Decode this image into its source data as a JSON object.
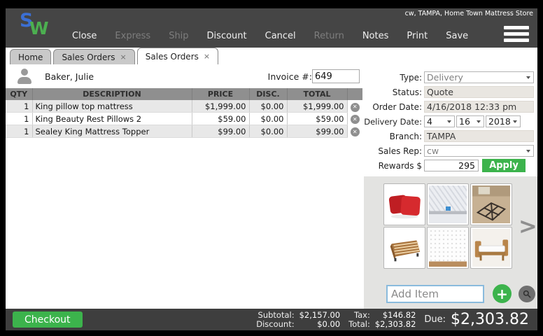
{
  "titlebar": {
    "account_label": "cw, TAMPA, Home Town Mattress Store"
  },
  "logo": {
    "letter_s": "S",
    "letter_w": "W"
  },
  "menu": {
    "items": [
      {
        "label": "Close",
        "enabled": true
      },
      {
        "label": "Express",
        "enabled": false
      },
      {
        "label": "Ship",
        "enabled": false
      },
      {
        "label": "Discount",
        "enabled": true
      },
      {
        "label": "Cancel",
        "enabled": true
      },
      {
        "label": "Return",
        "enabled": false
      },
      {
        "label": "Notes",
        "enabled": true
      },
      {
        "label": "Print",
        "enabled": true
      },
      {
        "label": "Save",
        "enabled": true
      }
    ]
  },
  "tabs": [
    {
      "label": "Home",
      "closable": false,
      "active": false
    },
    {
      "label": "Sales Orders",
      "closable": true,
      "active": false
    },
    {
      "label": "Sales Orders",
      "closable": true,
      "active": true
    }
  ],
  "customer": {
    "name": "Baker, Julie"
  },
  "invoice": {
    "label": "Invoice #:",
    "value": "649"
  },
  "order_table": {
    "headers": [
      "QTY",
      "DESCRIPTION",
      "PRICE",
      "DISC.",
      "TOTAL"
    ],
    "rows": [
      {
        "qty": "1",
        "description": "King pillow top mattress",
        "price": "$1,999.00",
        "disc": "$0.00",
        "total": "$1,999.00"
      },
      {
        "qty": "1",
        "description": "King Beauty Rest Pillows 2",
        "price": "$59.00",
        "disc": "$0.00",
        "total": "$59.00"
      },
      {
        "qty": "1",
        "description": "Sealey King Mattress Topper",
        "price": "$99.00",
        "disc": "$0.00",
        "total": "$99.00"
      }
    ]
  },
  "form": {
    "type": {
      "label": "Type:",
      "value": "Delivery"
    },
    "status": {
      "label": "Status:",
      "value": "Quote"
    },
    "order_date": {
      "label": "Order Date:",
      "value": "4/16/2018 12:33 pm"
    },
    "delivery_date": {
      "label": "Delivery Date:",
      "month": "4",
      "day": "16",
      "year": "2018"
    },
    "branch": {
      "label": "Branch:",
      "value": "TAMPA"
    },
    "sales_rep": {
      "label": "Sales Rep:",
      "value": "cw"
    },
    "rewards": {
      "label": "Rewards $",
      "value": "295",
      "apply_label": "Apply"
    }
  },
  "products": {
    "thumbnails": [
      "red-throw-pillows",
      "pillow-top-mattress-corner",
      "metal-bed-frame",
      "wood-slat-platform-bed",
      "white-mattress-corner",
      "wood-daybed"
    ]
  },
  "add_item": {
    "placeholder": "Add Item"
  },
  "totals": {
    "subtotal_label": "Subtotal:",
    "subtotal": "$2,157.00",
    "discount_label": "Discount:",
    "discount": "$0.00",
    "tax_label": "Tax:",
    "tax": "$146.82",
    "total_label": "Total:",
    "total": "$2,303.82",
    "due_label": "Due:",
    "due": "$2,303.82"
  },
  "checkout": {
    "label": "Checkout"
  },
  "icons": {
    "tab_close": "×",
    "row_delete": "✕",
    "next_arrow": ">",
    "plus": "+"
  },
  "colors": {
    "accent_green": "#3cb34c",
    "topbar_gray": "#454545",
    "logo_blue": "#3b6fd4",
    "logo_green": "#4caf50"
  }
}
